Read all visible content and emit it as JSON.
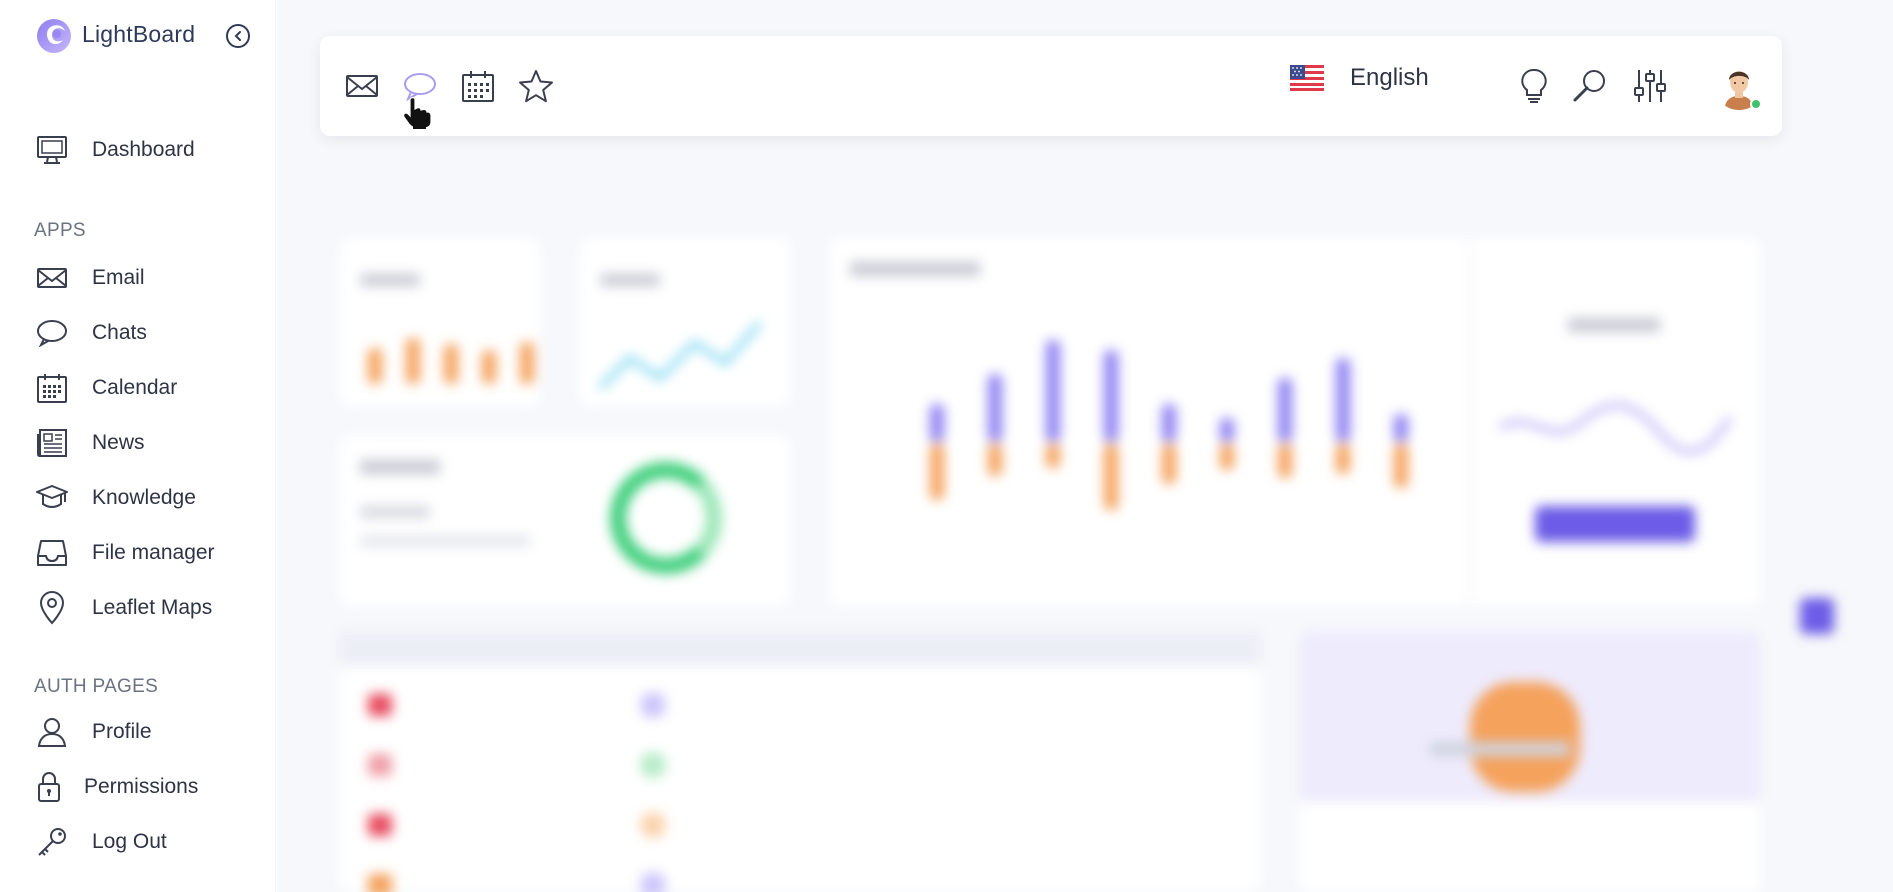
{
  "app": {
    "name": "LightBoard"
  },
  "sidebar": {
    "dashboard_label": "Dashboard",
    "apps_title": "APPS",
    "apps": [
      {
        "label": "Email",
        "icon": "envelope-icon"
      },
      {
        "label": "Chats",
        "icon": "chat-bubble-icon"
      },
      {
        "label": "Calendar",
        "icon": "calendar-icon"
      },
      {
        "label": "News",
        "icon": "newspaper-icon"
      },
      {
        "label": "Knowledge",
        "icon": "graduation-cap-icon"
      },
      {
        "label": "File manager",
        "icon": "inbox-tray-icon"
      },
      {
        "label": "Leaflet Maps",
        "icon": "map-pin-icon"
      }
    ],
    "auth_title": "AUTH PAGES",
    "auth": [
      {
        "label": "Profile",
        "icon": "user-icon"
      },
      {
        "label": "Permissions",
        "icon": "lock-icon"
      },
      {
        "label": "Log Out",
        "icon": "key-icon"
      }
    ]
  },
  "topbar": {
    "icons": [
      "envelope-icon",
      "chat-bubble-icon",
      "calendar-icon",
      "star-icon",
      "lightbulb-icon",
      "search-icon",
      "sliders-icon"
    ],
    "language": "English",
    "active_icon": "chat-bubble-icon"
  },
  "colors": {
    "accent": "#6c5ce7",
    "accent_light": "#a99cf2",
    "orange": "#f5a25d",
    "green": "#2ecc71",
    "text": "#2f3445"
  }
}
